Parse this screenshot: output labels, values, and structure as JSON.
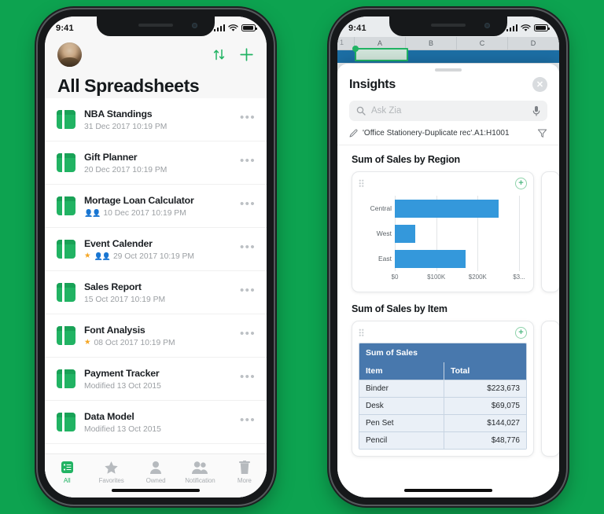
{
  "background_color": "#0da350",
  "accent_green": "#21b363",
  "chart_blue": "#3498db",
  "table_blue": "#4878ad",
  "left_phone": {
    "status": {
      "time": "9:41",
      "signal_icon": "cellular-bars-icon",
      "wifi_icon": "wifi-icon",
      "battery_icon": "battery-icon"
    },
    "header": {
      "avatar": "user-avatar",
      "sort_icon": "sort-arrows-icon",
      "add_icon": "plus-icon",
      "title": "All Spreadsheets"
    },
    "files": [
      {
        "name": "NBA Standings",
        "meta": "31 Dec 2017 10:19 PM",
        "starred": false,
        "shared": false
      },
      {
        "name": "Gift Planner",
        "meta": "20 Dec 2017 10:19 PM",
        "starred": false,
        "shared": false
      },
      {
        "name": "Mortage Loan Calculator",
        "meta": "10 Dec 2017 10:19 PM",
        "starred": false,
        "shared": true
      },
      {
        "name": "Event Calender",
        "meta": "29 Oct 2017 10:19 PM",
        "starred": true,
        "shared": true
      },
      {
        "name": "Sales Report",
        "meta": "15 Oct 2017 10:19 PM",
        "starred": false,
        "shared": false
      },
      {
        "name": "Font Analysis",
        "meta": "08 Oct 2017 10:19 PM",
        "starred": true,
        "shared": false
      },
      {
        "name": "Payment Tracker",
        "meta": "Modified 13 Oct 2015",
        "starred": false,
        "shared": false
      },
      {
        "name": "Data Model",
        "meta": "Modified 13 Oct 2015",
        "starred": false,
        "shared": false
      }
    ],
    "overflow_glyph": "•••",
    "tabs": [
      {
        "label": "All",
        "icon": "list-grid-icon",
        "active": true
      },
      {
        "label": "Favorites",
        "icon": "star-icon",
        "active": false
      },
      {
        "label": "Owned",
        "icon": "person-icon",
        "active": false
      },
      {
        "label": "Notification",
        "icon": "people-icon",
        "active": false
      },
      {
        "label": "More",
        "icon": "trash-icon",
        "active": false
      }
    ]
  },
  "right_phone": {
    "status": {
      "time": "9:41",
      "signal_icon": "cellular-bars-icon",
      "wifi_icon": "wifi-icon",
      "battery_icon": "battery-icon"
    },
    "spreadsheet": {
      "columns": [
        "A",
        "B",
        "C",
        "D"
      ],
      "row_label": "1"
    },
    "insights": {
      "title": "Insights",
      "close_icon": "close-circle-icon",
      "search": {
        "placeholder": "Ask Zia",
        "search_icon": "search-icon",
        "mic_icon": "microphone-icon"
      },
      "range": {
        "edit_icon": "pencil-icon",
        "text": "'Office Stationery-Duplicate rec'.A1:H1001",
        "filter_icon": "funnel-filter-icon"
      },
      "sections": [
        {
          "title": "Sum of Sales by Region",
          "grip_icon": "drag-grip-icon",
          "add_icon": "plus-circle-icon"
        },
        {
          "title": "Sum of Sales by Item",
          "grip_icon": "drag-grip-icon",
          "add_icon": "plus-circle-icon"
        }
      ],
      "pivot": {
        "caption": "Sum of Sales",
        "headers": [
          "Item",
          "Total"
        ],
        "rows": [
          [
            "Binder",
            "$223,673"
          ],
          [
            "Desk",
            "$69,075"
          ],
          [
            "Pen Set",
            "$144,027"
          ],
          [
            "Pencil",
            "$48,776"
          ]
        ]
      }
    }
  },
  "chart_data": [
    {
      "type": "bar",
      "orientation": "horizontal",
      "title": "Sum of Sales by Region",
      "categories": [
        "Central",
        "West",
        "East"
      ],
      "values": [
        250000,
        50000,
        170000
      ],
      "tick_labels": [
        "$0",
        "$100K",
        "$200K",
        "$3..."
      ],
      "tick_values": [
        0,
        100000,
        200000,
        300000
      ],
      "xlabel": "",
      "ylabel": "",
      "xlim": [
        0,
        300000
      ],
      "grid": true,
      "legend": "none",
      "series_color": "#3498db"
    },
    {
      "type": "table",
      "title": "Sum of Sales by Item",
      "caption": "Sum of Sales",
      "columns": [
        "Item",
        "Total"
      ],
      "rows": [
        [
          "Binder",
          223673
        ],
        [
          "Desk",
          69075
        ],
        [
          "Pen Set",
          144027
        ],
        [
          "Pencil",
          48776
        ]
      ]
    }
  ]
}
